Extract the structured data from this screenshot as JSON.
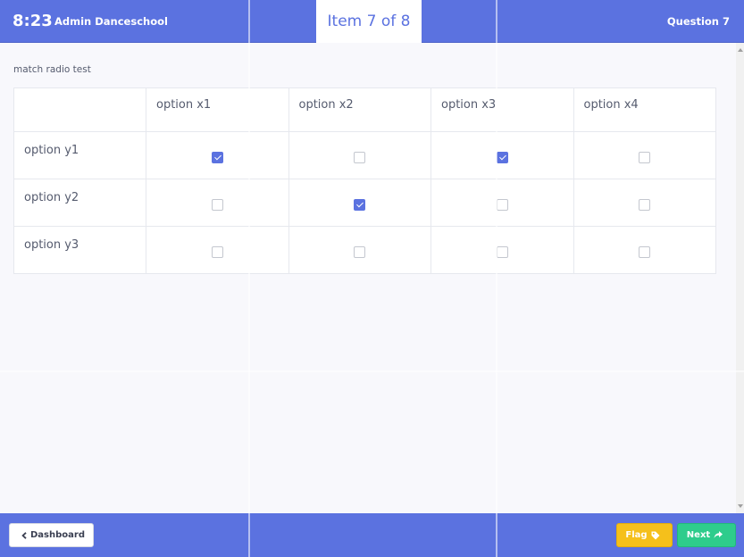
{
  "header": {
    "timer": "8:23",
    "user_name": "Admin Danceschool",
    "item_progress": "Item 7 of 8",
    "question_number": "Question 7"
  },
  "question": {
    "title": "match radio test",
    "columns": [
      "option x1",
      "option x2",
      "option x3",
      "option x4"
    ],
    "rows": [
      {
        "label": "option y1",
        "checked": [
          true,
          false,
          true,
          false
        ]
      },
      {
        "label": "option y2",
        "checked": [
          false,
          true,
          false,
          false
        ]
      },
      {
        "label": "option y3",
        "checked": [
          false,
          false,
          false,
          false
        ]
      }
    ]
  },
  "footer": {
    "dashboard_label": "Dashboard",
    "flag_label": "Flag",
    "next_label": "Next"
  },
  "icons": {
    "dashboard": "chevron-left-icon",
    "flag": "tag-icon",
    "next": "share-arrow-icon"
  },
  "colors": {
    "primary": "#5b72e0",
    "flag": "#f5c01b",
    "next": "#2ecc8c"
  }
}
